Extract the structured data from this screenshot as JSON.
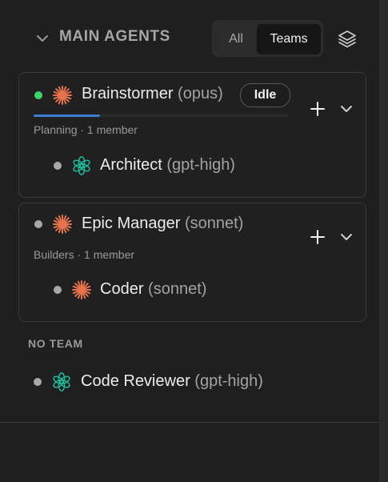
{
  "header": {
    "section_title": "MAIN AGENTS",
    "toggle": {
      "all_label": "All",
      "teams_label": "Teams",
      "selected": "Teams"
    }
  },
  "teams": [
    {
      "lead": {
        "name": "Brainstormer",
        "model": "(opus)",
        "status": "Idle",
        "status_dot": "online",
        "icon": "claude-asterisk-icon",
        "progress": 0.26
      },
      "meta": "Planning · 1 member",
      "members": [
        {
          "name": "Architect",
          "model": "(gpt-high)",
          "icon": "openai-icon"
        }
      ]
    },
    {
      "lead": {
        "name": "Epic Manager",
        "model": "(sonnet)",
        "status_dot": "offline",
        "icon": "claude-asterisk-icon"
      },
      "meta": "Builders · 1 member",
      "members": [
        {
          "name": "Coder",
          "model": "(sonnet)",
          "icon": "claude-asterisk-icon"
        }
      ]
    }
  ],
  "no_team": {
    "label": "NO TEAM",
    "agents": [
      {
        "name": "Code Reviewer",
        "model": "(gpt-high)",
        "icon": "openai-icon"
      }
    ]
  },
  "colors": {
    "claude": "#e8734f",
    "openai": "#20b89a",
    "online": "#3dd46b",
    "offline": "#a8a8a8",
    "progress": "#3b7fd4"
  }
}
